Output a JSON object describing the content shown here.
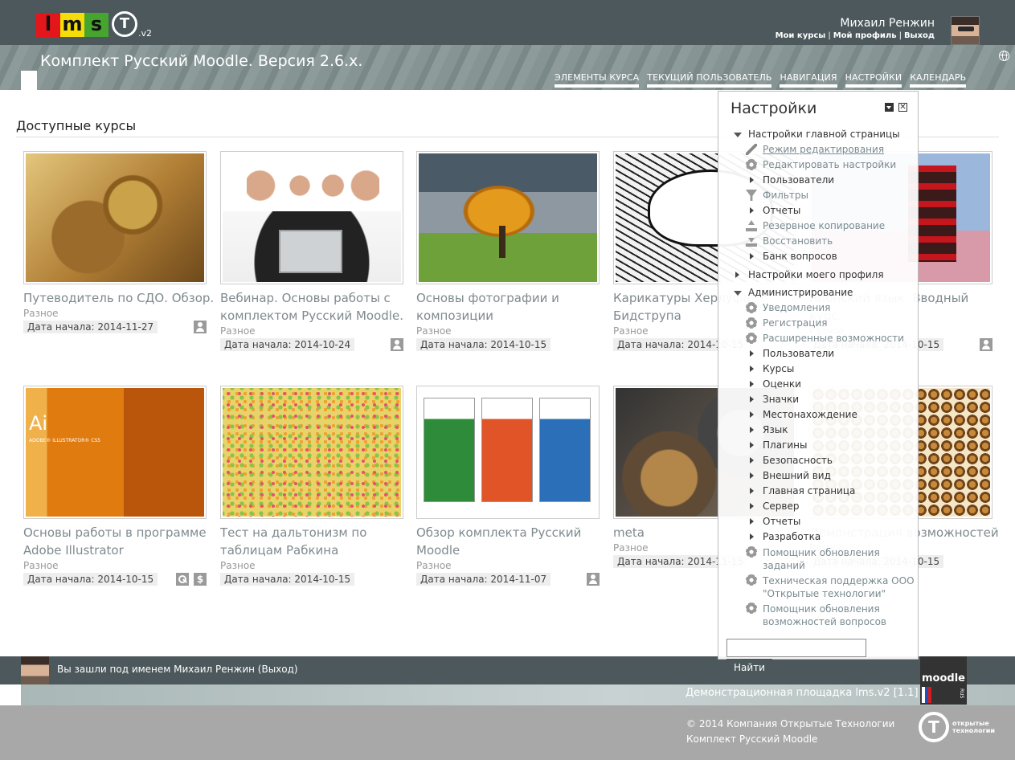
{
  "header": {
    "logo": {
      "l": "l",
      "m": "m",
      "s": "s",
      "t": "T",
      "version": ".v2"
    },
    "user_name": "Михаил Ренжин",
    "links": [
      "Мои курсы",
      "Мой профиль",
      "Выход"
    ],
    "link_separator": "|",
    "site_title": "Комплект Русский Moodle. Версия 2.6.x.",
    "nav": [
      "ЭЛЕМЕНТЫ КУРСА",
      "ТЕКУЩИЙ ПОЛЬЗОВАТЕЛЬ",
      "НАВИГАЦИЯ",
      "НАСТРОЙКИ",
      "КАЛЕНДАРЬ"
    ]
  },
  "main": {
    "section_title": "Доступные курсы",
    "courses": [
      {
        "title": "Путеводитель по СДО. Обзор.",
        "category": "Разное",
        "date": "Дата начала: 2014-11-27"
      },
      {
        "title": "Вебинар. Основы работы с комплектом Русский Moodle.",
        "category": "Разное",
        "date": "Дата начала: 2014-10-24"
      },
      {
        "title": "Основы фотографии и композиции",
        "category": "Разное",
        "date": "Дата начала: 2014-10-15"
      },
      {
        "title": "Карикатуры Херлуфа Бидструпа",
        "category": "Разное",
        "date": "Дата начала: 2014-10-15"
      },
      {
        "title": "Японский язык. Вводный курс.",
        "category": "Разное",
        "date": "Дата начала: 2014-10-15"
      },
      {
        "title": "Основы работы в программе Adobe Illustrator",
        "category": "Разное",
        "date": "Дата начала: 2014-10-15"
      },
      {
        "title": "Тест на дальтонизм по таблицам Рабкина",
        "category": "Разное",
        "date": "Дата начала: 2014-10-15"
      },
      {
        "title": "Обзор комплекта Русский Moodle",
        "category": "Разное",
        "date": "Дата начала: 2014-11-07"
      },
      {
        "title": "meta",
        "category": "Разное",
        "date": "Дата начала: 2014-11-15"
      },
      {
        "title": "Демонстрация возможностей",
        "category": "Разное",
        "date": "Дата начала: 2014-10-15"
      }
    ],
    "illustrator_thumb": {
      "ai": "Ai",
      "label": "ADOBE® ILLUSTRATOR® CS5"
    },
    "dollar_symbol": "$"
  },
  "settings": {
    "title": "Настройки",
    "close_symbol": "✕",
    "front_page": "Настройки главной страницы",
    "front_items": [
      "Режим редактирования",
      "Редактировать настройки",
      "Пользователи",
      "Фильтры",
      "Отчеты",
      "Резервное копирование",
      "Восстановить",
      "Банк вопросов"
    ],
    "profile": "Настройки моего профиля",
    "admin": "Администрирование",
    "admin_items": [
      "Уведомления",
      "Регистрация",
      "Расширенные возможности",
      "Пользователи",
      "Курсы",
      "Оценки",
      "Значки",
      "Местонахождение",
      "Язык",
      "Плагины",
      "Безопасность",
      "Внешний вид",
      "Главная страница",
      "Сервер",
      "Отчеты",
      "Разработка",
      "Помощник обновления заданий",
      "Техническая поддержка ООО \"Открытые технологии\"",
      "Помощник обновления возможностей вопросов"
    ],
    "search_value": "",
    "search_button": "Найти"
  },
  "footer": {
    "logged_in": "Вы зашли под именем Михаил Ренжин (Выход)",
    "demo": "Демонстрационная площадка lms.v2 [1.1]",
    "copyright": "© 2014 Компания Открытые Технологии",
    "kit": "Комплект Русский Moodle",
    "moodle_logo": "moodle",
    "rus": "RUS",
    "ot_logo_mark": "T",
    "ot_logo_text": [
      "открытые",
      "технологии"
    ]
  }
}
